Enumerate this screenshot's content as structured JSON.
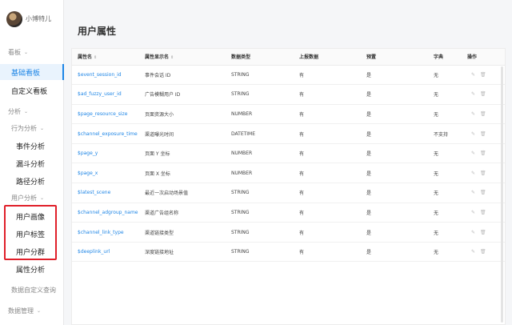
{
  "user": {
    "name": "小博特儿"
  },
  "sidebar": {
    "board_section": "看板",
    "board_items": [
      "基础看板",
      "自定义看板"
    ],
    "analysis_section": "分析",
    "behavior_section": "行为分析",
    "behavior_items": [
      "事件分析",
      "漏斗分析",
      "路径分析"
    ],
    "user_section": "用户分析",
    "user_items": [
      "用户画像",
      "用户标签",
      "用户分群"
    ],
    "attr_item": "属性分析",
    "custom_query": "数据自定义查询",
    "data_mgmt": "数据管理",
    "active_color": "#1f86e6",
    "highlight_color": "#e0202a"
  },
  "main": {
    "title": "用户属性",
    "columns": [
      "属性名",
      "属性显示名",
      "数据类型",
      "上报数据",
      "预置",
      "字典",
      "操作"
    ],
    "rows": [
      {
        "name": "$event_session_id",
        "display": "事件会话 ID",
        "type": "STRING",
        "reported": "有",
        "preset": "是",
        "dict": "无"
      },
      {
        "name": "$ad_fuzzy_user_id",
        "display": "广告模糊用户 ID",
        "type": "STRING",
        "reported": "有",
        "preset": "是",
        "dict": "无"
      },
      {
        "name": "$page_resource_size",
        "display": "页面资源大小",
        "type": "NUMBER",
        "reported": "有",
        "preset": "是",
        "dict": "无"
      },
      {
        "name": "$channel_exposure_time",
        "display": "渠道曝光时间",
        "type": "DATETIME",
        "reported": "有",
        "preset": "是",
        "dict": "不支持"
      },
      {
        "name": "$page_y",
        "display": "页面 Y 坐标",
        "type": "NUMBER",
        "reported": "有",
        "preset": "是",
        "dict": "无"
      },
      {
        "name": "$page_x",
        "display": "页面 X 坐标",
        "type": "NUMBER",
        "reported": "有",
        "preset": "是",
        "dict": "无"
      },
      {
        "name": "$latest_scene",
        "display": "最近一次启动场景值",
        "type": "STRING",
        "reported": "有",
        "preset": "是",
        "dict": "无"
      },
      {
        "name": "$channel_adgroup_name",
        "display": "渠道广告组名称",
        "type": "STRING",
        "reported": "有",
        "preset": "是",
        "dict": "无"
      },
      {
        "name": "$channel_link_type",
        "display": "渠道链接类型",
        "type": "STRING",
        "reported": "有",
        "preset": "是",
        "dict": "无"
      },
      {
        "name": "$deeplink_url",
        "display": "深度链接地址",
        "type": "STRING",
        "reported": "有",
        "preset": "是",
        "dict": "无"
      }
    ]
  },
  "icons": {
    "edit": "pencil-icon",
    "delete": "trash-icon",
    "sort": "sort-icon",
    "chevron": "chevron-down-icon"
  }
}
